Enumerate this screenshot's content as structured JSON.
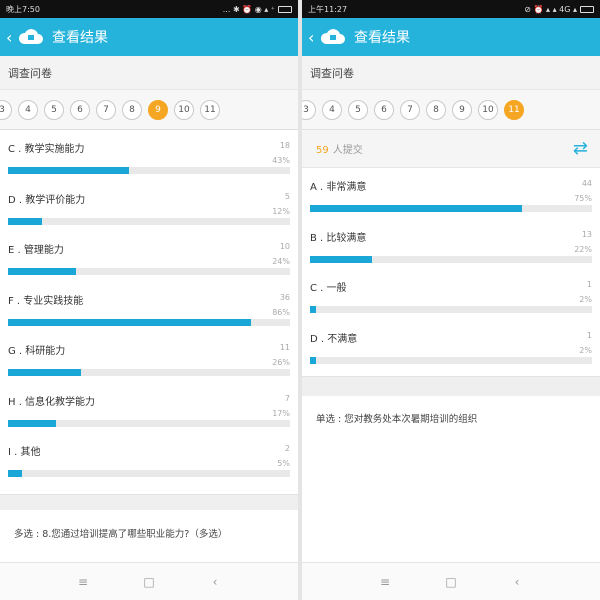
{
  "left": {
    "status": {
      "time": "晚上7:50",
      "icons": "... ✱ ⏰ ◉ ▴ ⁺"
    },
    "header": {
      "title": "查看结果"
    },
    "section_title": "调查问卷",
    "pager": [
      "3",
      "4",
      "5",
      "6",
      "7",
      "8",
      "9",
      "10",
      "11"
    ],
    "pager_active": "9",
    "options": [
      {
        "label": "C . 教学实施能力",
        "count": "18",
        "pct": "43%",
        "ratio": 0.43
      },
      {
        "label": "D . 教学评价能力",
        "count": "5",
        "pct": "12%",
        "ratio": 0.12
      },
      {
        "label": "E . 管理能力",
        "count": "10",
        "pct": "24%",
        "ratio": 0.24
      },
      {
        "label": "F . 专业实践技能",
        "count": "36",
        "pct": "86%",
        "ratio": 0.86
      },
      {
        "label": "G . 科研能力",
        "count": "11",
        "pct": "26%",
        "ratio": 0.26
      },
      {
        "label": "H . 信息化教学能力",
        "count": "7",
        "pct": "17%",
        "ratio": 0.17
      },
      {
        "label": "I . 其他",
        "count": "2",
        "pct": "5%",
        "ratio": 0.05
      }
    ],
    "question": "多选 : 8.您通过培训提高了哪些职业能力?（多选）"
  },
  "right": {
    "status": {
      "time": "上午11:27",
      "icons": "⊘ ⏰ ▴ ▴ 4G ▴"
    },
    "header": {
      "title": "查看结果"
    },
    "section_title": "调查问卷",
    "pager": [
      "3",
      "4",
      "5",
      "6",
      "7",
      "8",
      "9",
      "10",
      "11"
    ],
    "pager_active": "11",
    "summary": {
      "count": "59",
      "text": "人提交"
    },
    "options": [
      {
        "label": "A . 非常满意",
        "count": "44",
        "pct": "75%",
        "ratio": 0.75
      },
      {
        "label": "B . 比较满意",
        "count": "13",
        "pct": "22%",
        "ratio": 0.22
      },
      {
        "label": "C . 一般",
        "count": "1",
        "pct": "2%",
        "ratio": 0.02
      },
      {
        "label": "D . 不满意",
        "count": "1",
        "pct": "2%",
        "ratio": 0.02
      }
    ],
    "question": "单选 : 您对教务处本次暑期培训的组织"
  },
  "nav": {
    "menu": "≡",
    "home": "□",
    "back": "‹"
  },
  "colors": {
    "accent": "#25b3dc",
    "bar": "#1aa6d6",
    "active_page": "#f5a623"
  }
}
